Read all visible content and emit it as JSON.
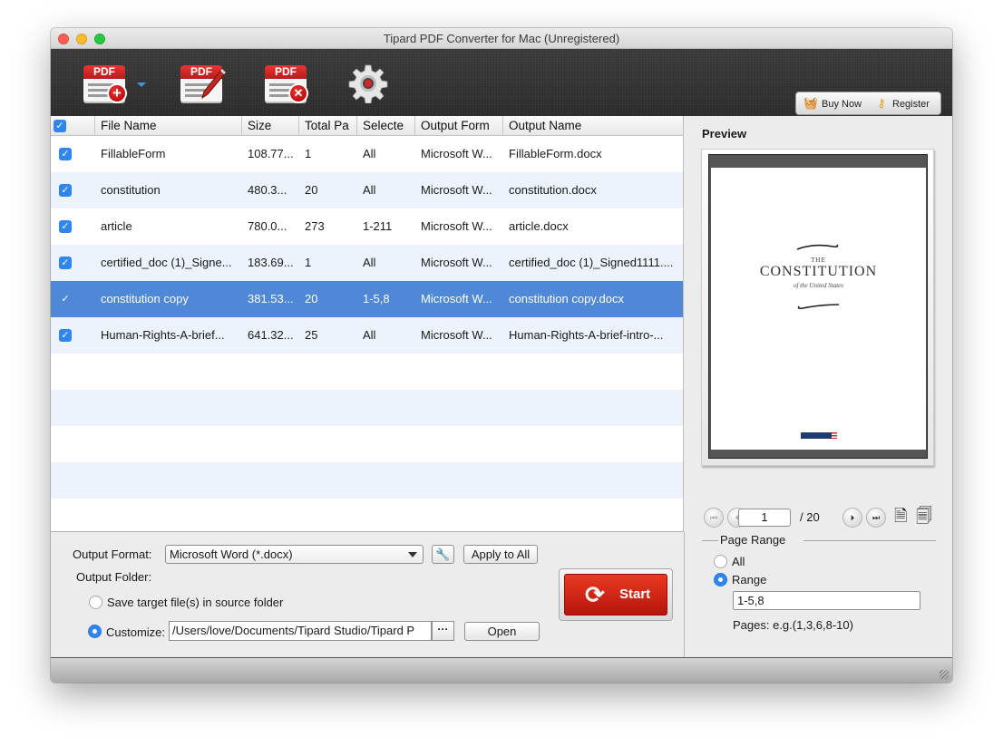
{
  "window": {
    "title": "Tipard PDF Converter for Mac (Unregistered)"
  },
  "toolbar": {
    "buttons": [
      {
        "name": "add-pdf",
        "label": "PDF",
        "badge": "+"
      },
      {
        "name": "edit-pdf",
        "label": "PDF"
      },
      {
        "name": "remove-pdf",
        "label": "PDF",
        "badge": "✕"
      },
      {
        "name": "preferences"
      }
    ],
    "buy_now_label": "Buy Now",
    "register_label": "Register"
  },
  "table": {
    "columns": [
      "File Name",
      "Size",
      "Total Pa",
      "Selecte",
      "Output Form",
      "Output Name"
    ],
    "rows": [
      {
        "checked": true,
        "file_name": "FillableForm",
        "size": "108.77...",
        "total_pages": "1",
        "selected": "All",
        "output_format": "Microsoft W...",
        "output_name": "FillableForm.docx"
      },
      {
        "checked": true,
        "file_name": "constitution",
        "size": "480.3...",
        "total_pages": "20",
        "selected": "All",
        "output_format": "Microsoft W...",
        "output_name": "constitution.docx"
      },
      {
        "checked": true,
        "file_name": "article",
        "size": "780.0...",
        "total_pages": "273",
        "selected": "1-211",
        "output_format": "Microsoft W...",
        "output_name": "article.docx"
      },
      {
        "checked": true,
        "file_name": "certified_doc (1)_Signe...",
        "size": "183.69...",
        "total_pages": "1",
        "selected": "All",
        "output_format": "Microsoft W...",
        "output_name": "certified_doc (1)_Signed1111...."
      },
      {
        "checked": true,
        "file_name": "constitution copy",
        "size": "381.53...",
        "total_pages": "20",
        "selected": "1-5,8",
        "output_format": "Microsoft W...",
        "output_name": "constitution copy.docx",
        "is_selected": true
      },
      {
        "checked": true,
        "file_name": "Human-Rights-A-brief...",
        "size": "641.32...",
        "total_pages": "25",
        "selected": "All",
        "output_format": "Microsoft W...",
        "output_name": "Human-Rights-A-brief-intro-..."
      }
    ]
  },
  "output": {
    "format_label": "Output Format:",
    "format_value": "Microsoft Word (*.docx)",
    "apply_all_label": "Apply to All",
    "folder_label": "Output Folder:",
    "save_source_label": "Save target file(s) in source folder",
    "customize_label": "Customize:",
    "path_value": "/Users/love/Documents/Tipard Studio/Tipard P",
    "browse_label": "···",
    "open_label": "Open",
    "start_label": "Start"
  },
  "preview": {
    "title": "Preview",
    "doc_the": "THE",
    "doc_title": "CONSTITUTION",
    "doc_subtitle": "of the United States",
    "current_page": "1",
    "total_pages": "/ 20"
  },
  "page_range": {
    "legend": "Page Range",
    "all_label": "All",
    "range_label": "Range",
    "range_value": "1-5,8",
    "hint": "Pages: e.g.(1,3,6,8-10)",
    "selected_option": "Range"
  },
  "colors": {
    "selection": "#4e88d6",
    "alt_row": "#edf3fc",
    "accent": "#2f86f0",
    "start_red": "#d42a18"
  }
}
